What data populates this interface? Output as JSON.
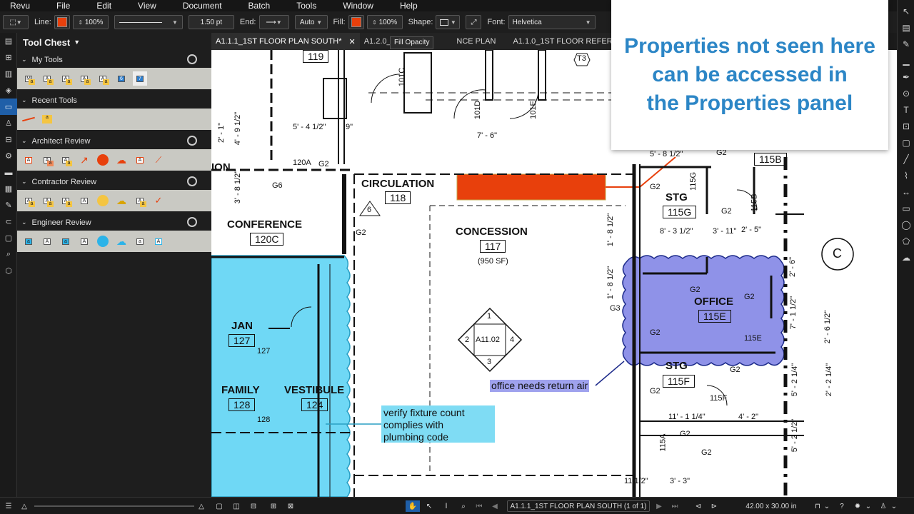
{
  "menu": [
    "Revu",
    "File",
    "Edit",
    "View",
    "Document",
    "Batch",
    "Tools",
    "Window",
    "Help"
  ],
  "toolbar": {
    "line_label": "Line:",
    "line_color": "#e8400c",
    "line_opacity": "100%",
    "line_width": "1.50 pt",
    "end_label": "End:",
    "end_value": "Auto",
    "fill_label": "Fill:",
    "fill_color": "#e8400c",
    "fill_opacity": "100%",
    "shape_label": "Shape:",
    "font_label": "Font:",
    "font_value": "Helvetica"
  },
  "tooltip": "Fill Opacity",
  "tabs": [
    {
      "label": "A1.1.1_1ST FLOOR PLAN SOUTH*",
      "active": true
    },
    {
      "label": "A1.2.0_2ND F"
    },
    {
      "label": "NCE PLAN"
    },
    {
      "label": "A1.1.0_1ST FLOOR  REFERENCE PLAN"
    }
  ],
  "tool_chest": {
    "title": "Tool Chest",
    "sections": [
      {
        "name": "My Tools",
        "tools": [
          "M",
          "A",
          "A",
          "A",
          "A",
          "6",
          "7"
        ]
      },
      {
        "name": "Recent Tools",
        "tools": [
          "line",
          "a"
        ]
      },
      {
        "name": "Architect Review",
        "tools": [
          "A",
          "A",
          "A",
          "A",
          "A",
          "A",
          "A",
          "A"
        ]
      },
      {
        "name": "Contractor Review",
        "tools": [
          "A",
          "A",
          "A",
          "A",
          "A",
          "A",
          "A",
          "A"
        ]
      },
      {
        "name": "Engineer Review",
        "tools": [
          "a",
          "A",
          "a",
          "A",
          "A",
          "A",
          "a",
          "A"
        ]
      }
    ]
  },
  "banner": "Properties not seen here\ncan be accessed in\nthe Properties panel",
  "drawing": {
    "rooms": [
      {
        "name": "CIRCULATION",
        "num": "118"
      },
      {
        "name": "CONFERENCE",
        "num": "120C"
      },
      {
        "name": "CONCESSION",
        "num": "117",
        "sub": "(950 SF)"
      },
      {
        "name": "STG",
        "num": "115G"
      },
      {
        "name": "OFFICE",
        "num": "115E"
      },
      {
        "name": "STG",
        "num": "115F"
      },
      {
        "name": "JAN",
        "num": "127"
      },
      {
        "name": "FAMILY",
        "num": "128"
      },
      {
        "name": "VESTIBULE",
        "num": "124"
      },
      {
        "name": "ION"
      }
    ],
    "room_tags": [
      "119",
      "115B"
    ],
    "door_tags": [
      "101C",
      "101D",
      "101E",
      "120A",
      "115G",
      "115B",
      "115E",
      "115F",
      "115A",
      "127",
      "128"
    ],
    "dims": [
      "5' - 4 1/2\"",
      "9\"",
      "7' - 6\"",
      "5' - 8 1/2\"",
      "8' - 3 1/2\"",
      "3' - 11\"",
      "2' - 5\"",
      "2' - 1\"",
      "4' - 9 1/2\"",
      "3' - 8 1/2\"",
      "1' - 8 1/2\"",
      "1' - 8 1/2\"",
      "2' - 6\"",
      "7' - 1 1/2\"",
      "2' - 6 1/2\"",
      "2' - 2 1/4\"",
      "5' - 2 1/4\"",
      "5' - 2 1/2\"",
      "11' - 1 1/4\"",
      "4' - 2\"",
      "3' - 3\"",
      "11 1/2\""
    ],
    "g_tags": [
      "G2",
      "G2",
      "G2",
      "G2",
      "G2",
      "G2",
      "G2",
      "G2",
      "G2",
      "G2",
      "G2",
      "G2",
      "G6",
      "G3"
    ],
    "key_tag": {
      "center": "A11.02",
      "top": "1",
      "left": "2",
      "right": "4",
      "bottom": "3"
    },
    "triangle_tag": "6",
    "t3_tag": "T3",
    "grid_bubble": "C",
    "callout_fixture": "verify fixture count\ncomplies with\nplumbing code",
    "callout_office": "office needs return air"
  },
  "statusbar": {
    "page_label": "A1.1.1_1ST FLOOR PLAN SOUTH (1 of 1)",
    "page_size": "42.00 x 30.00 in"
  },
  "colors": {
    "accent": "#1f5fa8",
    "cloud_cyan": "#6fd8f5",
    "cloud_blue": "#8f92e8",
    "markup_orange": "#e8400c",
    "banner_text": "#2c86c6"
  }
}
